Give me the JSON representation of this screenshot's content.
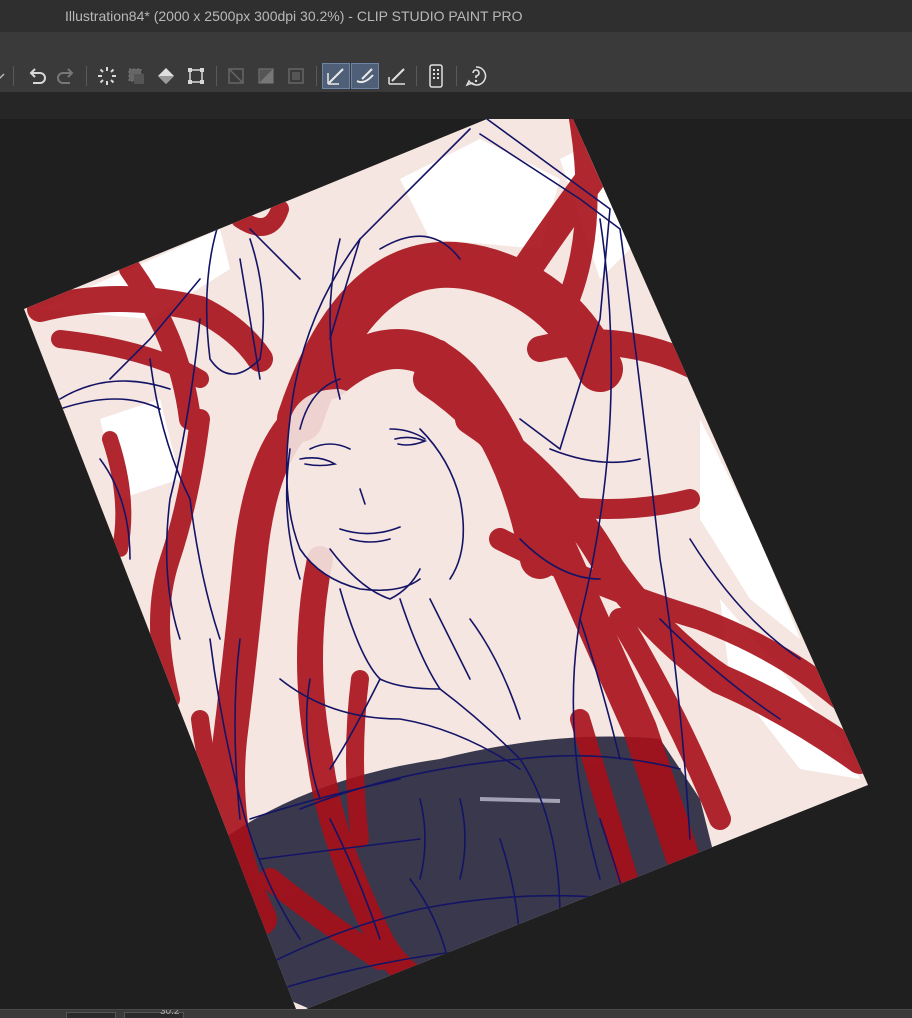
{
  "window": {
    "title": "Illustration84* (2000 x 2500px 300dpi 30.2%)  - CLIP STUDIO PAINT PRO"
  },
  "toolbar": {
    "buttons": [
      {
        "name": "dropdown-chevron-icon"
      },
      {
        "name": "undo-icon"
      },
      {
        "name": "redo-icon"
      },
      {
        "name": "deselect-icon"
      },
      {
        "name": "invert-selection-icon"
      },
      {
        "name": "fill-selection-icon"
      },
      {
        "name": "transform-icon"
      },
      {
        "name": "clear-outside-selection-icon"
      },
      {
        "name": "clear-icon"
      },
      {
        "name": "fill-icon"
      },
      {
        "name": "snap-to-ruler-icon",
        "active": true
      },
      {
        "name": "snap-to-special-ruler-icon",
        "active": true
      },
      {
        "name": "snap-to-grid-icon"
      },
      {
        "name": "smartphone-companion-icon"
      },
      {
        "name": "help-icon"
      }
    ]
  },
  "statusbar": {
    "zoom_value": "30.2"
  },
  "colors": {
    "titlebar": "#2f2f2f",
    "toolbar": "#3a3a3a",
    "canvas_bg": "#1f1f1f",
    "paper": "#f5e6e1",
    "hair": "#a8101a",
    "sketch": "#141466",
    "dress": "#2e2e44",
    "active_button": "#4f5f78"
  }
}
